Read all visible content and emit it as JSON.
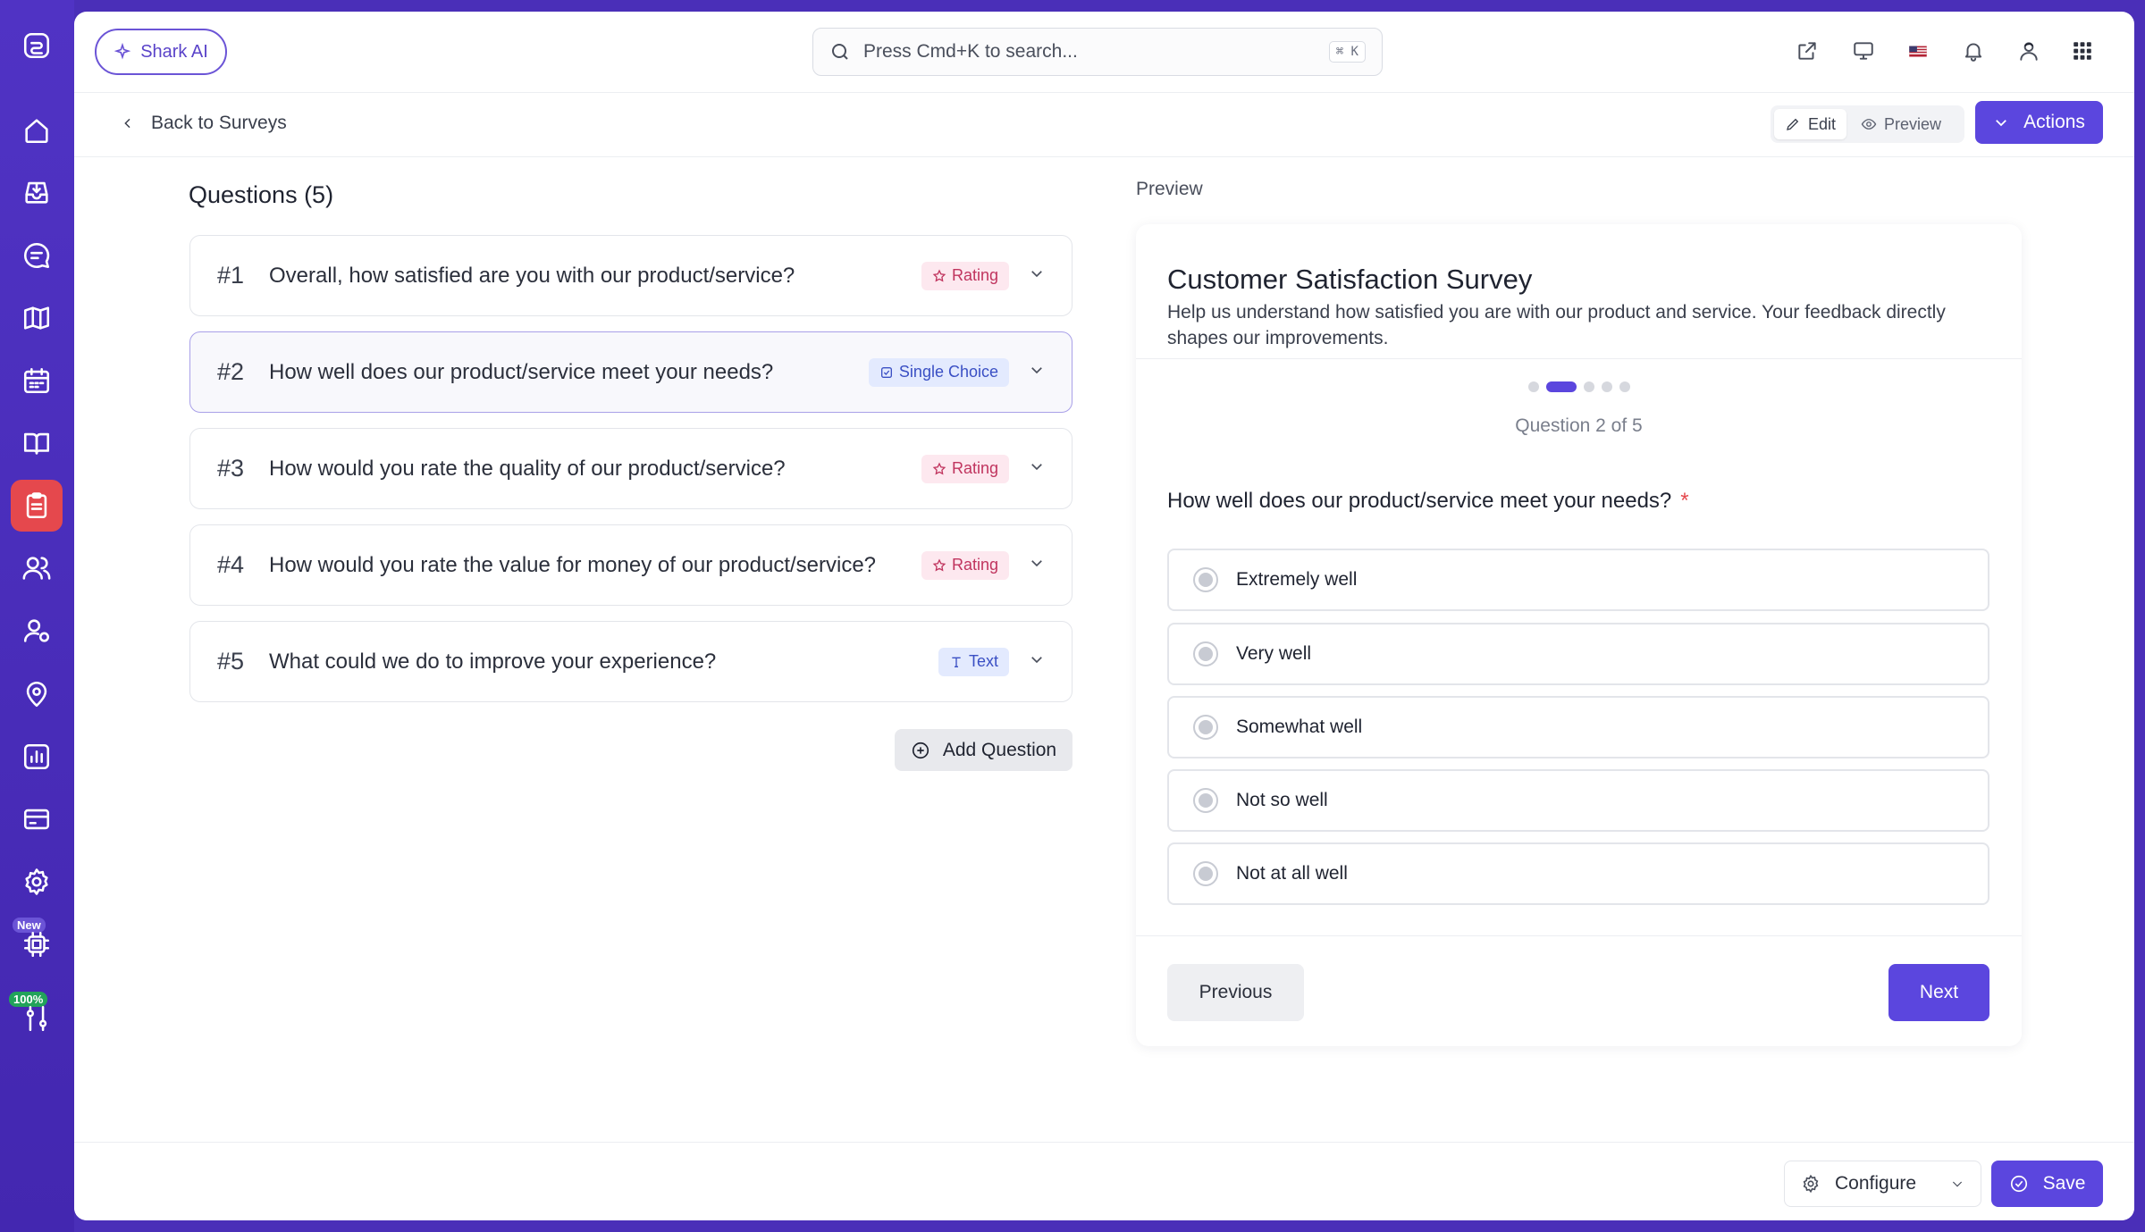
{
  "colors": {
    "rail_bg": "#4a2fb8",
    "accent": "#5b46de",
    "active_rail_item": "#e5484d",
    "rating_tag": "#c0345e",
    "choice_tag": "#3a4fc4",
    "required_marker": "#e5484d"
  },
  "rail": {
    "items": [
      {
        "name": "logo",
        "icon": "logo-icon"
      },
      {
        "name": "home",
        "icon": "home-icon"
      },
      {
        "name": "inbox",
        "icon": "inbox-download-icon"
      },
      {
        "name": "chat",
        "icon": "chat-icon"
      },
      {
        "name": "map",
        "icon": "map-icon"
      },
      {
        "name": "calendar",
        "icon": "calendar-icon"
      },
      {
        "name": "knowledge",
        "icon": "book-icon"
      },
      {
        "name": "surveys",
        "icon": "clipboard-icon",
        "active": true
      },
      {
        "name": "users",
        "icon": "users-icon"
      },
      {
        "name": "user-settings",
        "icon": "user-gear-icon"
      },
      {
        "name": "location",
        "icon": "location-icon"
      },
      {
        "name": "reports",
        "icon": "bar-chart-icon"
      },
      {
        "name": "billing",
        "icon": "credit-card-icon"
      },
      {
        "name": "settings",
        "icon": "gear-icon"
      },
      {
        "name": "chip",
        "icon": "chip-icon"
      },
      {
        "name": "tuning",
        "icon": "sliders-icon"
      }
    ],
    "badge_new": "New",
    "badge_percent": "100%"
  },
  "topbar": {
    "ai_button": "Shark AI",
    "search_placeholder": "Press Cmd+K to search...",
    "search_shortcut": "⌘ K",
    "icons": [
      "external-link-icon",
      "monitor-icon",
      "us-flag-icon",
      "bell-icon",
      "avatar",
      "apps-grid-icon"
    ]
  },
  "subbar": {
    "back_label": "Back to Surveys",
    "edit_label": "Edit",
    "preview_label": "Preview",
    "actions_label": "Actions"
  },
  "questions": {
    "heading": "Questions (5)",
    "items": [
      {
        "num": "#1",
        "text": "Overall, how satisfied are you with our product/service?",
        "type": "Rating"
      },
      {
        "num": "#2",
        "text": "How well does our product/service meet your needs?",
        "type": "Single Choice",
        "selected": true
      },
      {
        "num": "#3",
        "text": "How would you rate the quality of our product/service?",
        "type": "Rating"
      },
      {
        "num": "#4",
        "text": "How would you rate the value for money of our product/service?",
        "type": "Rating"
      },
      {
        "num": "#5",
        "text": "What could we do to improve your experience?",
        "type": "Text"
      }
    ],
    "add_label": "Add Question"
  },
  "preview": {
    "label": "Preview",
    "title": "Customer Satisfaction Survey",
    "description": "Help us understand how satisfied you are with our product and service. Your feedback directly shapes our improvements.",
    "progress": {
      "current": 2,
      "total": 5
    },
    "count_label": "Question 2 of 5",
    "question": "How well does our product/service meet your needs?",
    "required_mark": "*",
    "options": [
      "Extremely well",
      "Very well",
      "Somewhat well",
      "Not so well",
      "Not at all well"
    ],
    "prev_label": "Previous",
    "next_label": "Next"
  },
  "bottombar": {
    "configure_label": "Configure",
    "save_label": "Save"
  }
}
